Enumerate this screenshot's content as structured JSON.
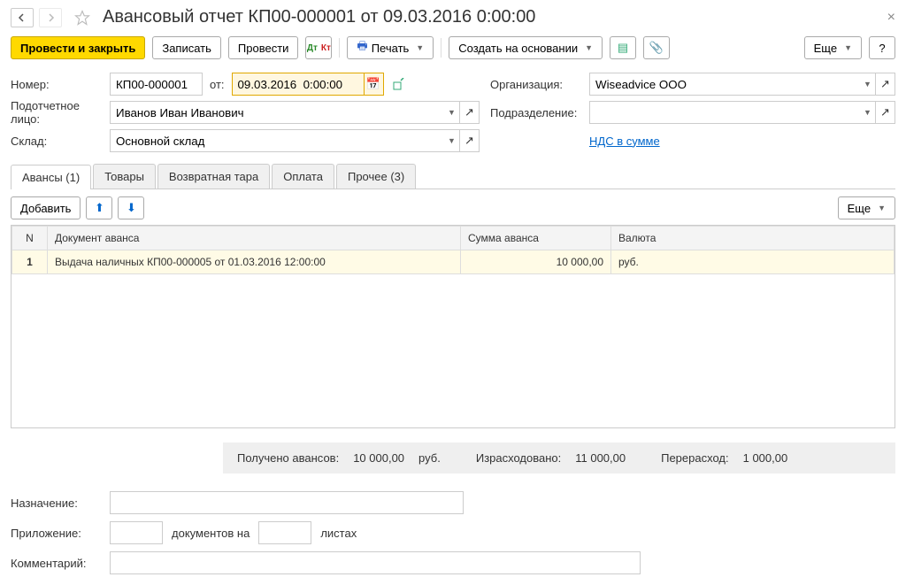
{
  "header": {
    "title": "Авансовый отчет КП00-000001 от 09.03.2016 0:00:00"
  },
  "toolbar": {
    "post_close": "Провести и закрыть",
    "save": "Записать",
    "post": "Провести",
    "print": "Печать",
    "create_based": "Создать на основании",
    "more": "Еще"
  },
  "form": {
    "number_label": "Номер:",
    "number_value": "КП00-000001",
    "from_label": "от:",
    "date_value": "09.03.2016  0:00:00",
    "org_label": "Организация:",
    "org_value": "Wiseadvice ООО",
    "person_label": "Подотчетное лицо:",
    "person_value": "Иванов Иван Иванович",
    "dept_label": "Подразделение:",
    "dept_value": "",
    "warehouse_label": "Склад:",
    "warehouse_value": "Основной склад",
    "vat_link": "НДС в сумме"
  },
  "tabs": {
    "advances": "Авансы (1)",
    "goods": "Товары",
    "containers": "Возвратная тара",
    "payment": "Оплата",
    "other": "Прочее (3)"
  },
  "table_toolbar": {
    "add": "Добавить",
    "more": "Еще"
  },
  "table": {
    "col_n": "N",
    "col_doc": "Документ аванса",
    "col_sum": "Сумма аванса",
    "col_cur": "Валюта",
    "rows": [
      {
        "n": "1",
        "doc": "Выдача наличных КП00-000005 от 01.03.2016 12:00:00",
        "sum": "10 000,00",
        "cur": "руб."
      }
    ]
  },
  "summary": {
    "received_label": "Получено авансов:",
    "received_value": "10 000,00",
    "received_cur": "руб.",
    "spent_label": "Израсходовано:",
    "spent_value": "11 000,00",
    "over_label": "Перерасход:",
    "over_value": "1 000,00"
  },
  "bottom": {
    "purpose_label": "Назначение:",
    "purpose_value": "",
    "attachment_label": "Приложение:",
    "attach_docs": "",
    "attach_text1": "документов на",
    "attach_sheets": "",
    "attach_text2": "листах",
    "comment_label": "Комментарий:",
    "comment_value": ""
  }
}
